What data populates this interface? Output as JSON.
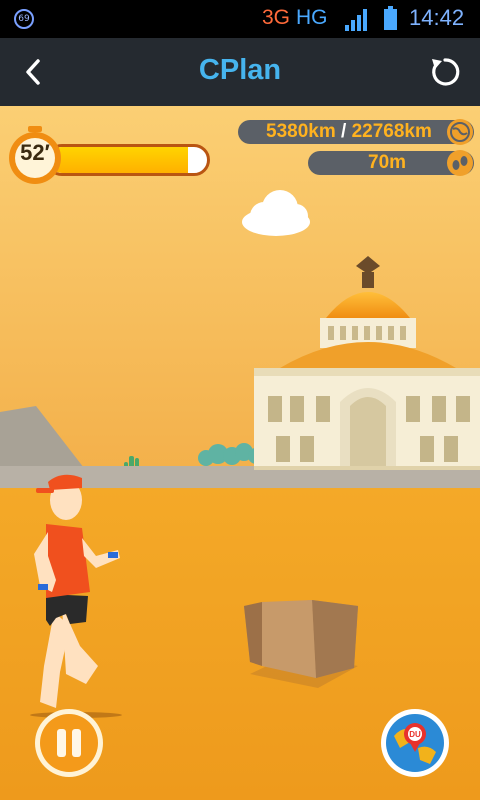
{
  "status_bar": {
    "notification_badge": "69",
    "network_3g": "3G",
    "network_hg": "HG",
    "time": "14:42"
  },
  "app_bar": {
    "title": "CPlan",
    "back_icon": "back-chevron-icon",
    "refresh_icon": "refresh-icon"
  },
  "hud": {
    "timer": "52′",
    "progress_fraction": 0.88,
    "distance_current": "5380km",
    "distance_separator": " / ",
    "distance_total": "22768km",
    "steps": "70m",
    "distance_icon": "globe-icon",
    "steps_icon": "footprints-icon"
  },
  "controls": {
    "pause_icon": "pause-icon",
    "map_icon": "world-map-icon",
    "map_badge": "DU"
  },
  "colors": {
    "accent_blue": "#46b4ee",
    "accent_orange": "#ffb21f",
    "sky": "#f6c060",
    "ground": "#f2a020"
  }
}
